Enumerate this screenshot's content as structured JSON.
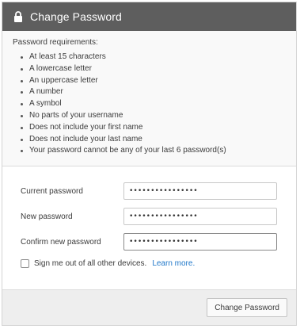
{
  "header": {
    "title": "Change Password",
    "icon": "lock-icon"
  },
  "requirements": {
    "heading": "Password requirements:",
    "items": [
      "At least 15 characters",
      "A lowercase letter",
      "An uppercase letter",
      "A number",
      "A symbol",
      "No parts of your username",
      "Does not include your first name",
      "Does not include your last name",
      "Your password cannot be any of your last 6 password(s)"
    ]
  },
  "form": {
    "current": {
      "label": "Current password",
      "value": "••••••••••••••••"
    },
    "new": {
      "label": "New password",
      "value": "••••••••••••••••"
    },
    "confirm": {
      "label": "Confirm new password",
      "value": "••••••••••••••••"
    },
    "signout": {
      "label": "Sign me out of all other devices.",
      "link": "Learn more."
    }
  },
  "footer": {
    "submit_label": "Change Password"
  },
  "colors": {
    "header_bg": "#5e5e5e",
    "link": "#1f77c9",
    "panel_bg": "#f9f9f9"
  }
}
